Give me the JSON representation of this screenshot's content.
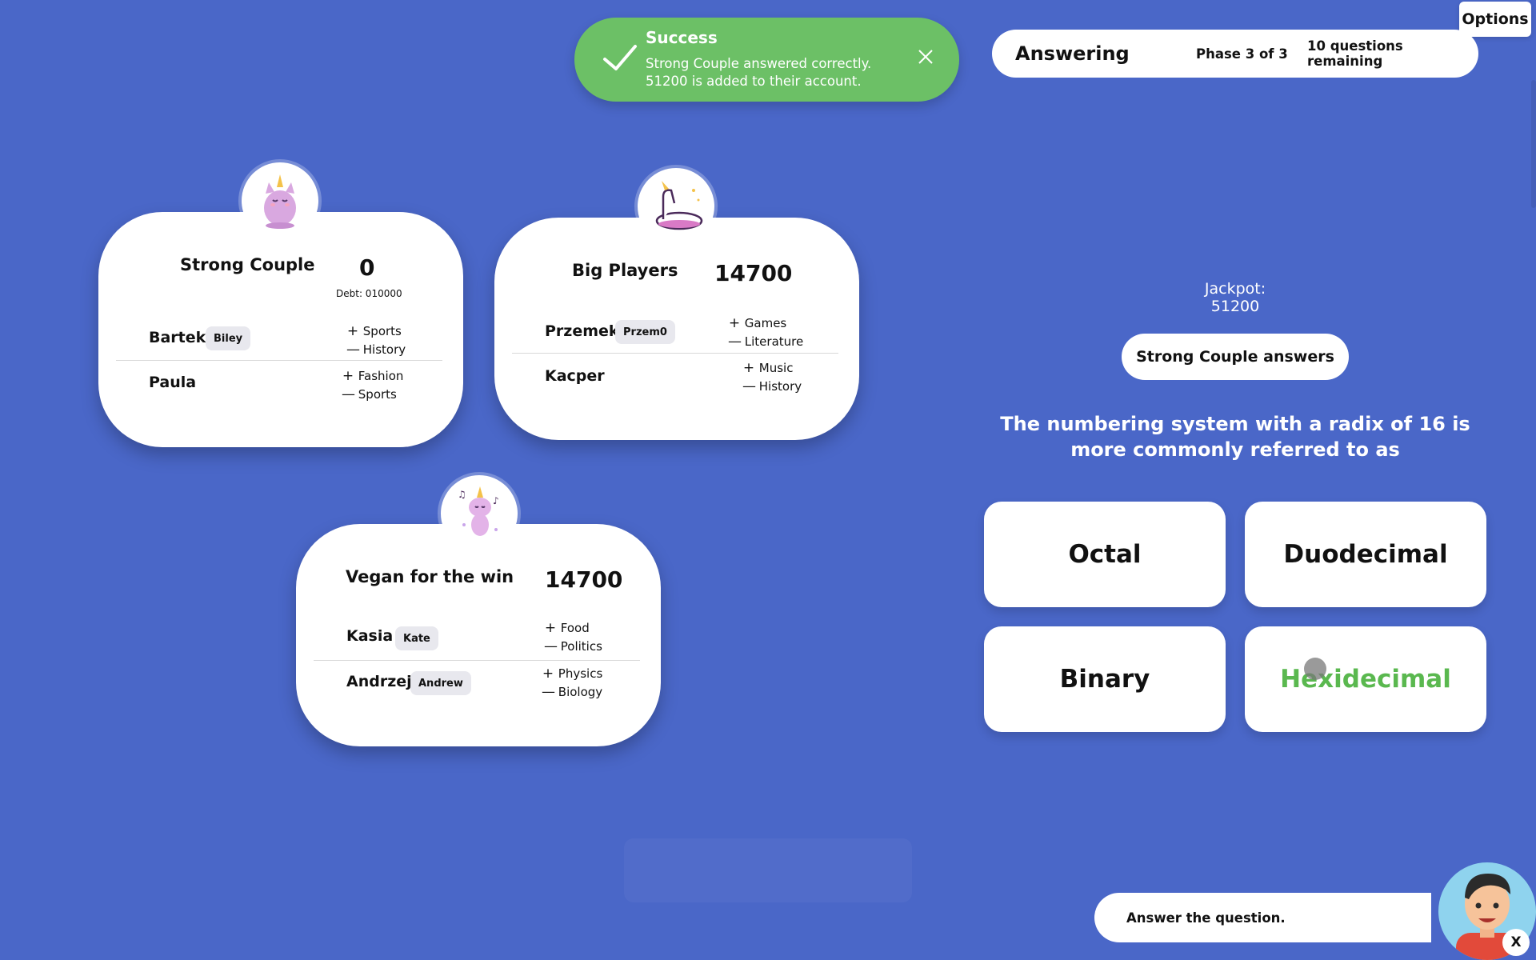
{
  "options": {
    "label": "Options"
  },
  "toast": {
    "title": "Success",
    "line1": "Strong Couple answered correctly.",
    "line2": "51200 is added to their account."
  },
  "status": {
    "phase_title": "Answering",
    "phase": "Phase 3 of 3",
    "remaining": "10 questions remaining"
  },
  "teams": [
    {
      "name": "Strong Couple",
      "score": "0",
      "debt": "Debt: 010000",
      "avatar_icon": "unicorn-cat-icon",
      "players": [
        {
          "name": "Bartek",
          "nick": "Biley",
          "plus": "Sports",
          "minus": "History"
        },
        {
          "name": "Paula",
          "nick": "",
          "plus": "Fashion",
          "minus": "Sports"
        }
      ]
    },
    {
      "name": "Big Players",
      "score": "14700",
      "avatar_icon": "unicorn-float-icon",
      "players": [
        {
          "name": "Przemek",
          "nick": "Przem0",
          "plus": "Games",
          "minus": "Literature"
        },
        {
          "name": "Kacper",
          "nick": "",
          "plus": "Music",
          "minus": "History"
        }
      ]
    },
    {
      "name": "Vegan for the win",
      "score": "14700",
      "avatar_icon": "dancing-unicorn-icon",
      "players": [
        {
          "name": "Kasia",
          "nick": "Kate",
          "plus": "Food",
          "minus": "Politics"
        },
        {
          "name": "Andrzej",
          "nick": "Andrew",
          "plus": "Physics",
          "minus": "Biology"
        }
      ]
    }
  ],
  "jackpot": "Jackpot: 51200",
  "answering_team": "Strong Couple answers",
  "question": "The numbering system with a radix of 16 is more commonly referred to as",
  "answers": [
    "Octal",
    "Duodecimal",
    "Binary",
    "Hexidecimal"
  ],
  "correct_color": "#5ab84f",
  "host": {
    "message": "Answer the question.",
    "close": "X",
    "avatar_icon": "host-avatar-icon"
  },
  "colors": {
    "background": "#4a67c8",
    "success": "#6cc066"
  }
}
